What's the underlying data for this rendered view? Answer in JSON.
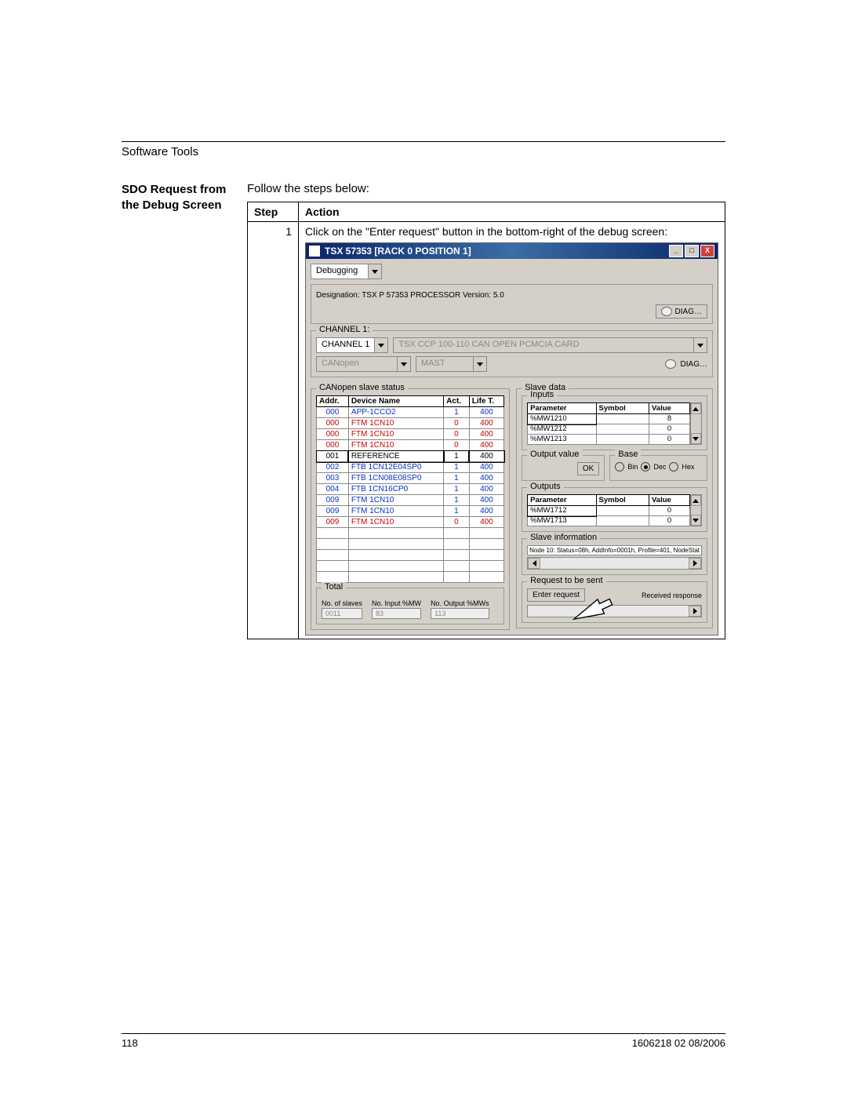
{
  "header": "Software Tools",
  "sectionTitle": "SDO Request from the Debug Screen",
  "intro": "Follow the steps below:",
  "table": {
    "stepHeader": "Step",
    "actionHeader": "Action",
    "stepNum": "1",
    "actionText": "Click on the \"Enter request\" button in the bottom-right of the debug screen:"
  },
  "window": {
    "title": "TSX 57353 [RACK 0   POSITION 1]",
    "tab": "Debugging",
    "designation": "Designation: TSX P 57353 PROCESSOR   Version: 5.0",
    "diagBtn": "DIAG…",
    "channelLabel": "CHANNEL 1:",
    "channelCombo": "CHANNEL 1",
    "cardText": "TSX CCP 100-110 CAN OPEN PCMCIA CARD",
    "protoCombo": "CANopen",
    "mastCombo": "MAST",
    "diag2": "DIAG…",
    "slaveStatusTitle": "CANopen slave status",
    "slaveDataTitle": "Slave data",
    "inputsTitle": "Inputs",
    "outputValueTitle": "Output value",
    "baseTitle": "Base",
    "outputsTitle": "Outputs",
    "slaveInfoTitle": "Slave information",
    "slaveInfoText": "Node 10: Status=08h, AddInfo=0001h, Profile=401, NodeStat",
    "requestTitle": "Request to be sent",
    "receivedResp": "Received response",
    "enterRequest": "Enter request",
    "totalTitle": "Total",
    "noSlaves": "No. of slaves",
    "noInput": "No. Input %MW",
    "noOutput": "No. Output %MWs",
    "totalSlaves": "0011",
    "totalInput": "83",
    "totalOutput": "113",
    "okBtn": "OK",
    "baseBin": "Bin",
    "baseDec": "Dec",
    "baseHex": "Hex"
  },
  "slaveCols": {
    "addr": "Addr.",
    "device": "Device Name",
    "act": "Act.",
    "life": "Life T."
  },
  "slaveRows": [
    {
      "addr": "000",
      "device": "APP-1CCO2",
      "act": "1",
      "life": "400",
      "cls": "blue"
    },
    {
      "addr": "000",
      "device": "FTM 1CN10",
      "act": "0",
      "life": "400",
      "cls": "red"
    },
    {
      "addr": "000",
      "device": "FTM 1CN10",
      "act": "0",
      "life": "400",
      "cls": "red"
    },
    {
      "addr": "000",
      "device": "FTM 1CN10",
      "act": "0",
      "life": "400",
      "cls": "red"
    },
    {
      "addr": "001",
      "device": "REFERENCE",
      "act": "1",
      "life": "400",
      "cls": ""
    },
    {
      "addr": "002",
      "device": "FTB 1CN12E04SP0",
      "act": "1",
      "life": "400",
      "cls": "blue"
    },
    {
      "addr": "003",
      "device": "FTB 1CN08E08SP0",
      "act": "1",
      "life": "400",
      "cls": "blue"
    },
    {
      "addr": "004",
      "device": "FTB 1CN16CP0",
      "act": "1",
      "life": "400",
      "cls": "blue"
    },
    {
      "addr": "009",
      "device": "FTM 1CN10",
      "act": "1",
      "life": "400",
      "cls": "blue"
    },
    {
      "addr": "009",
      "device": "FTM 1CN10",
      "act": "1",
      "life": "400",
      "cls": "blue"
    },
    {
      "addr": "009",
      "device": "FTM 1CN10",
      "act": "0",
      "life": "400",
      "cls": "red"
    }
  ],
  "ioCols": {
    "param": "Parameter",
    "symbol": "Symbol",
    "value": "Value"
  },
  "inputsRows": [
    {
      "param": "%MW1210",
      "symbol": "",
      "value": "8"
    },
    {
      "param": "%MW1212",
      "symbol": "",
      "value": "0"
    },
    {
      "param": "%MW1213",
      "symbol": "",
      "value": "0"
    }
  ],
  "outputsRows": [
    {
      "param": "%MW1712",
      "symbol": "",
      "value": "0"
    },
    {
      "param": "%MW1713",
      "symbol": "",
      "value": "0"
    }
  ],
  "footer": {
    "pageNum": "118",
    "docRef": "1606218 02 08/2006"
  }
}
